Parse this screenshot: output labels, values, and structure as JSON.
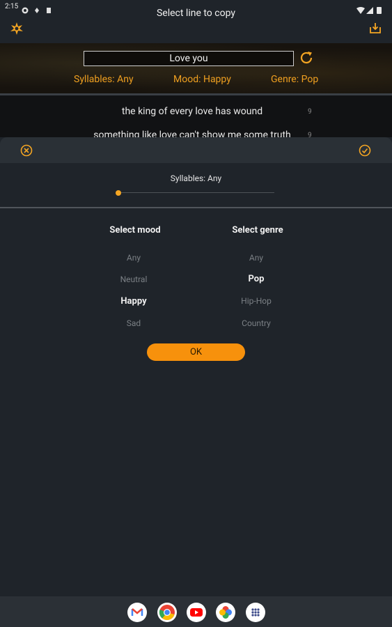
{
  "status_bar": {
    "time": "2:15"
  },
  "app_bar": {
    "title": "Select line to copy"
  },
  "search": {
    "value": "Love you"
  },
  "filters": {
    "syllables": "Syllables: Any",
    "mood": "Mood: Happy",
    "genre": "Genre: Pop"
  },
  "results": [
    {
      "text": "the king of every love has wound",
      "count": "9"
    },
    {
      "text": "something like love can't show me some truth",
      "count": "9"
    }
  ],
  "sheet": {
    "syllables_label": "Syllables: Any",
    "slider_value_fraction": 0.0,
    "mood": {
      "title": "Select mood",
      "options": [
        "Any",
        "Neutral",
        "Happy",
        "Sad"
      ],
      "selected": "Happy"
    },
    "genre": {
      "title": "Select genre",
      "options": [
        "Any",
        "Pop",
        "Hip-Hop",
        "Country"
      ],
      "selected": "Pop"
    },
    "ok_label": "OK"
  },
  "colors": {
    "accent": "#f5a623",
    "button": "#f7910c",
    "background": "#1f242a"
  },
  "dock_apps": [
    "gmail-icon",
    "chrome-icon",
    "youtube-icon",
    "photos-icon",
    "app-drawer-icon"
  ]
}
